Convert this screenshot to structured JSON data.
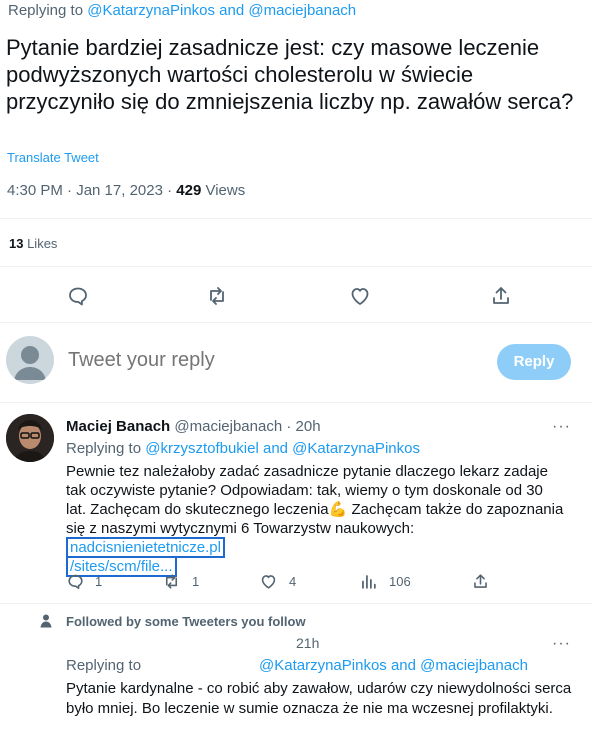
{
  "header": {
    "replying_prefix": "Replying to",
    "replying_users": "@KatarzynaPinkos and @maciejbanach"
  },
  "main_tweet": {
    "text": "Pytanie bardziej zasadnicze jest: czy masowe leczenie podwyższonych wartości cholesterolu w świecie przyczyniło się do zmniejszenia liczby np. zawałów serca?",
    "translate_label": "Translate Tweet",
    "time": "4:30 PM · Jan 17, 2023 · ",
    "views_count": "429",
    "views_label": " Views",
    "likes_count": "13",
    "likes_label": " Likes"
  },
  "composer": {
    "placeholder": "Tweet your reply",
    "button_label": "Reply"
  },
  "reply1": {
    "name": "Maciej Banach",
    "handle": "@maciejbanach",
    "sep": " · ",
    "time": "20h",
    "more": "···",
    "replying_prefix": "Replying to ",
    "replying_users": "@krzysztofbukiel and @KatarzynaPinkos",
    "body_part1": "Pewnie tez należałoby zadać zasadnicze pytanie dlaczego lekarz zadaje tak oczywiste pytanie? Odpowiadam: tak, wiemy o tym doskonale od 30 lat. Zachęcam do skutecznego leczenia",
    "emoji": "💪",
    "body_part2": " Zachęcam także do zapoznania się z naszymi wytycznymi 6 Towarzystw naukowych: ",
    "link1": "nadcisnienietetnicze.pl",
    "link2": "/sites/scm/file...",
    "stats": {
      "replies": "1",
      "retweets": "1",
      "likes": "4",
      "views": "106"
    }
  },
  "followed_label": "Followed by some Tweeters you follow",
  "reply2": {
    "time": "21h",
    "more": "···",
    "replying_prefix": "Replying to",
    "replying_users": "@KatarzynaPinkos and @maciejbanach",
    "body": "Pytanie kardynalne - co robić aby zawałow, udarów czy niewydolności serca było mniej. Bo leczenie w sumie oznacza że nie ma wczesnej profilaktyki."
  },
  "colors": {
    "accent": "#1d9bf0",
    "reply_button_disabled": "#8ecdf8",
    "secondary_text": "#536471"
  }
}
